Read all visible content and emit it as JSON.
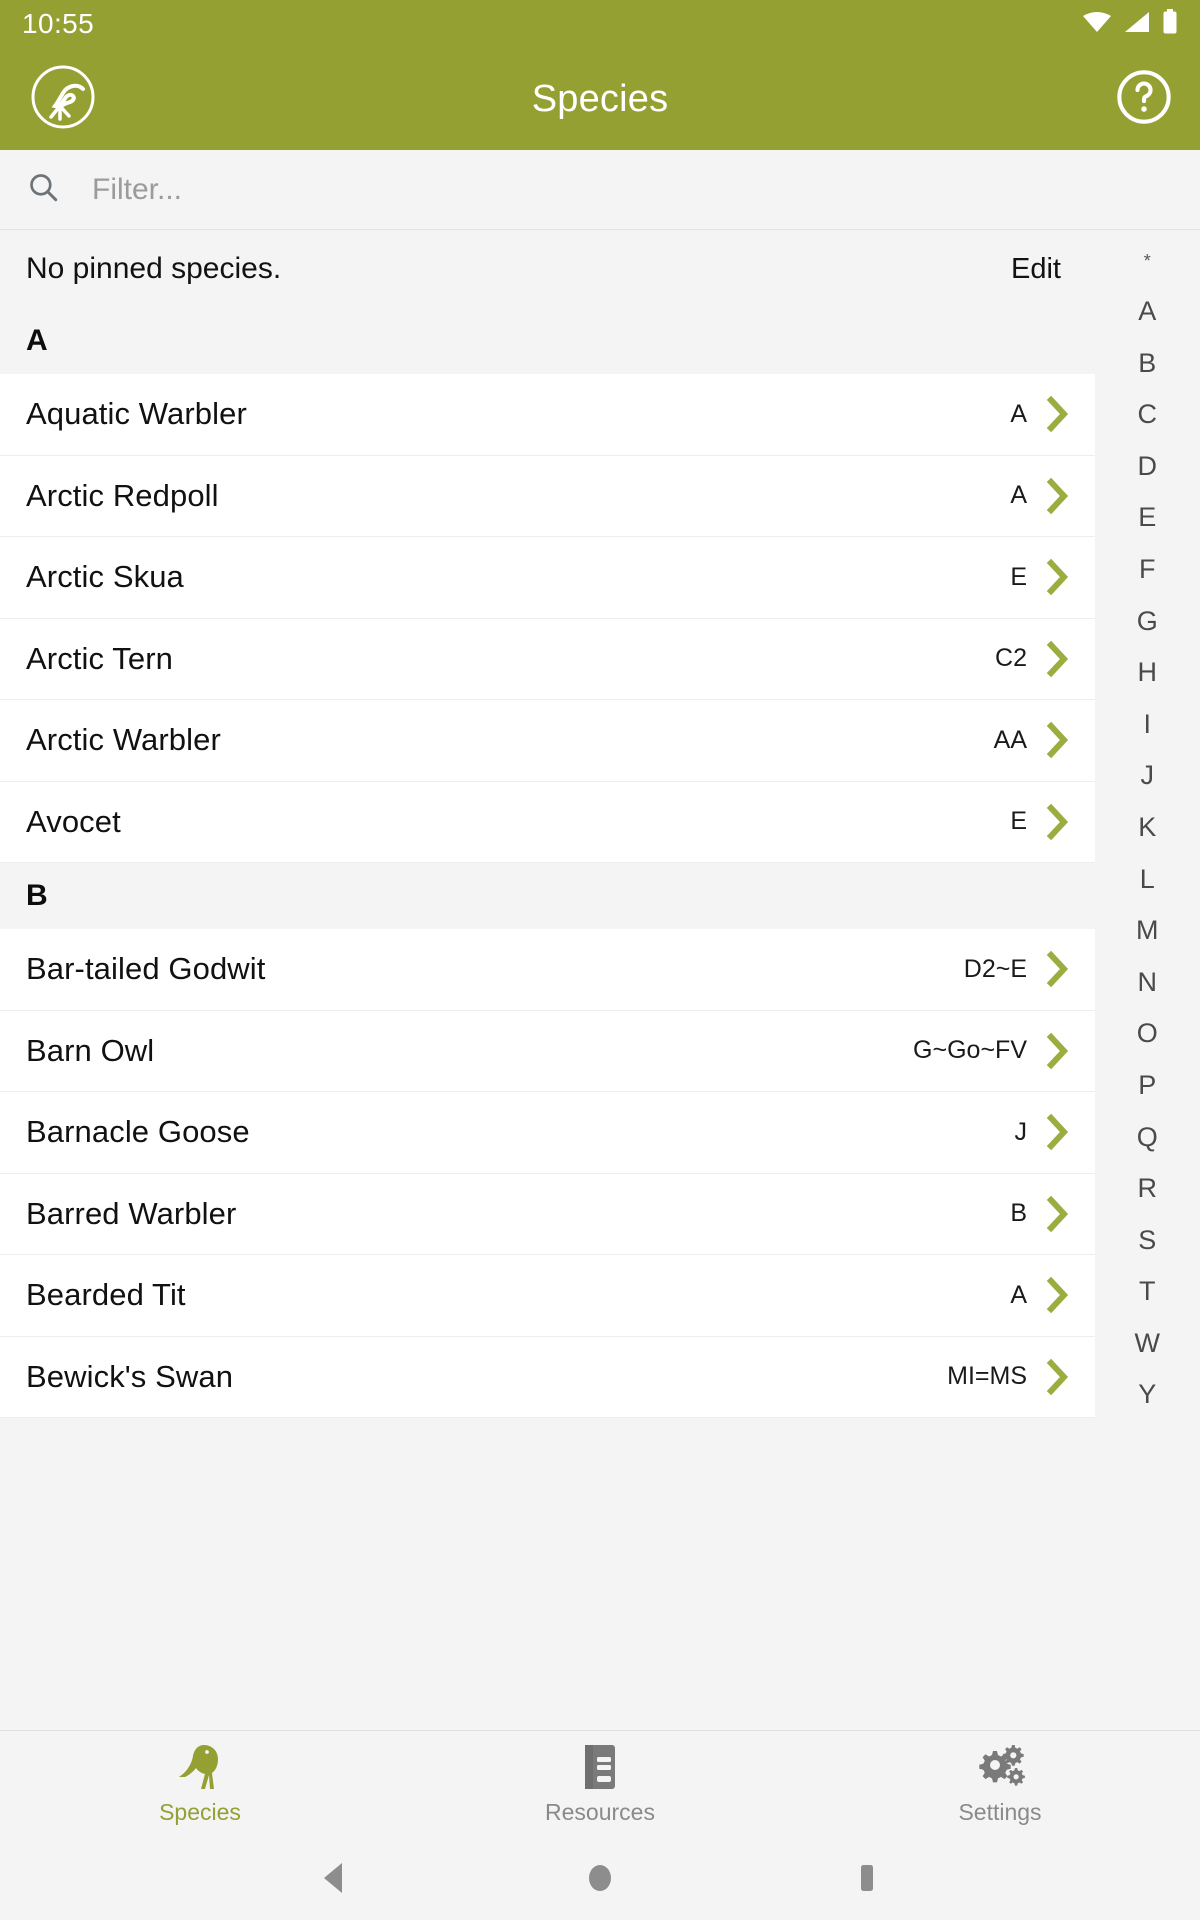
{
  "statusbar": {
    "time": "10:55",
    "icons": [
      "wifi-icon",
      "cellular-signal-icon",
      "battery-icon"
    ]
  },
  "appbar": {
    "title": "Species",
    "logo_icon": "bird-logo-icon",
    "help_icon": "help-circle-icon"
  },
  "search": {
    "icon": "search-icon",
    "placeholder": "Filter...",
    "value": ""
  },
  "pinned": {
    "label": "No pinned species.",
    "edit_label": "Edit"
  },
  "index_bar": {
    "items": [
      "*",
      "A",
      "B",
      "C",
      "D",
      "E",
      "F",
      "G",
      "H",
      "I",
      "J",
      "K",
      "L",
      "M",
      "N",
      "O",
      "P",
      "Q",
      "R",
      "S",
      "T",
      "W",
      "Y"
    ]
  },
  "sections": [
    {
      "letter": "A",
      "rows": [
        {
          "name": "Aquatic Warbler",
          "code": "A"
        },
        {
          "name": "Arctic Redpoll",
          "code": "A"
        },
        {
          "name": "Arctic Skua",
          "code": "E"
        },
        {
          "name": "Arctic Tern",
          "code": "C2"
        },
        {
          "name": "Arctic Warbler",
          "code": "AA"
        },
        {
          "name": "Avocet",
          "code": "E"
        }
      ]
    },
    {
      "letter": "B",
      "rows": [
        {
          "name": "Bar-tailed Godwit",
          "code": "D2~E"
        },
        {
          "name": "Barn Owl",
          "code": "G~Go~FV"
        },
        {
          "name": "Barnacle Goose",
          "code": "J"
        },
        {
          "name": "Barred Warbler",
          "code": "B"
        },
        {
          "name": "Bearded Tit",
          "code": "A"
        },
        {
          "name": "Bewick's Swan",
          "code": "MI=MS"
        }
      ]
    }
  ],
  "tabs": [
    {
      "label": "Species",
      "icon": "bird-icon",
      "active": true
    },
    {
      "label": "Resources",
      "icon": "book-icon",
      "active": false
    },
    {
      "label": "Settings",
      "icon": "gears-icon",
      "active": false
    }
  ],
  "android_nav": {
    "back": "back-triangle-icon",
    "home": "home-circle-icon",
    "recents": "recents-square-icon"
  },
  "colors": {
    "brand_green": "#94a032",
    "chevron_green": "#9aad3f",
    "page_bg": "#f4f4f4",
    "row_bg": "#ffffff",
    "tab_inactive": "#8a8a8a"
  }
}
